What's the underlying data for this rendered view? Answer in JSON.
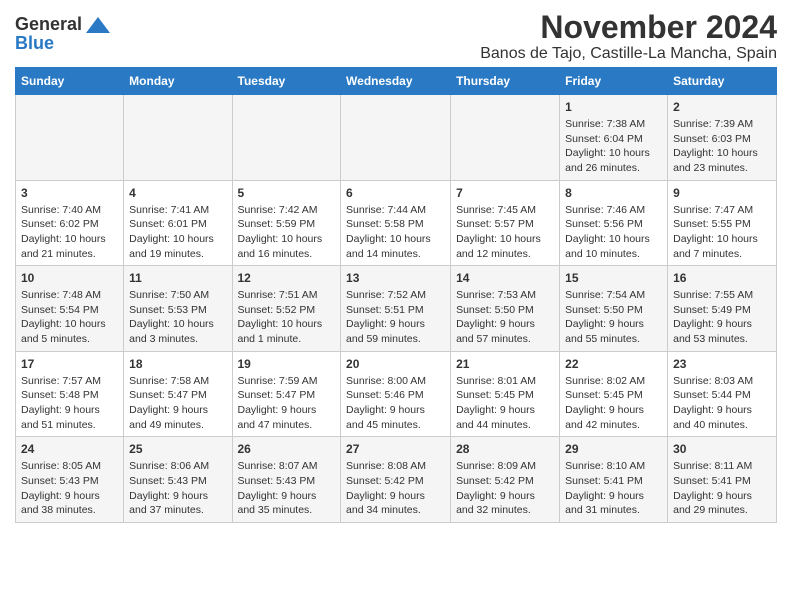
{
  "header": {
    "logo_general": "General",
    "logo_blue": "Blue",
    "title": "November 2024",
    "subtitle": "Banos de Tajo, Castille-La Mancha, Spain"
  },
  "days_of_week": [
    "Sunday",
    "Monday",
    "Tuesday",
    "Wednesday",
    "Thursday",
    "Friday",
    "Saturday"
  ],
  "weeks": [
    [
      {
        "day": "",
        "content": ""
      },
      {
        "day": "",
        "content": ""
      },
      {
        "day": "",
        "content": ""
      },
      {
        "day": "",
        "content": ""
      },
      {
        "day": "",
        "content": ""
      },
      {
        "day": "1",
        "content": "Sunrise: 7:38 AM\nSunset: 6:04 PM\nDaylight: 10 hours and 26 minutes."
      },
      {
        "day": "2",
        "content": "Sunrise: 7:39 AM\nSunset: 6:03 PM\nDaylight: 10 hours and 23 minutes."
      }
    ],
    [
      {
        "day": "3",
        "content": "Sunrise: 7:40 AM\nSunset: 6:02 PM\nDaylight: 10 hours and 21 minutes."
      },
      {
        "day": "4",
        "content": "Sunrise: 7:41 AM\nSunset: 6:01 PM\nDaylight: 10 hours and 19 minutes."
      },
      {
        "day": "5",
        "content": "Sunrise: 7:42 AM\nSunset: 5:59 PM\nDaylight: 10 hours and 16 minutes."
      },
      {
        "day": "6",
        "content": "Sunrise: 7:44 AM\nSunset: 5:58 PM\nDaylight: 10 hours and 14 minutes."
      },
      {
        "day": "7",
        "content": "Sunrise: 7:45 AM\nSunset: 5:57 PM\nDaylight: 10 hours and 12 minutes."
      },
      {
        "day": "8",
        "content": "Sunrise: 7:46 AM\nSunset: 5:56 PM\nDaylight: 10 hours and 10 minutes."
      },
      {
        "day": "9",
        "content": "Sunrise: 7:47 AM\nSunset: 5:55 PM\nDaylight: 10 hours and 7 minutes."
      }
    ],
    [
      {
        "day": "10",
        "content": "Sunrise: 7:48 AM\nSunset: 5:54 PM\nDaylight: 10 hours and 5 minutes."
      },
      {
        "day": "11",
        "content": "Sunrise: 7:50 AM\nSunset: 5:53 PM\nDaylight: 10 hours and 3 minutes."
      },
      {
        "day": "12",
        "content": "Sunrise: 7:51 AM\nSunset: 5:52 PM\nDaylight: 10 hours and 1 minute."
      },
      {
        "day": "13",
        "content": "Sunrise: 7:52 AM\nSunset: 5:51 PM\nDaylight: 9 hours and 59 minutes."
      },
      {
        "day": "14",
        "content": "Sunrise: 7:53 AM\nSunset: 5:50 PM\nDaylight: 9 hours and 57 minutes."
      },
      {
        "day": "15",
        "content": "Sunrise: 7:54 AM\nSunset: 5:50 PM\nDaylight: 9 hours and 55 minutes."
      },
      {
        "day": "16",
        "content": "Sunrise: 7:55 AM\nSunset: 5:49 PM\nDaylight: 9 hours and 53 minutes."
      }
    ],
    [
      {
        "day": "17",
        "content": "Sunrise: 7:57 AM\nSunset: 5:48 PM\nDaylight: 9 hours and 51 minutes."
      },
      {
        "day": "18",
        "content": "Sunrise: 7:58 AM\nSunset: 5:47 PM\nDaylight: 9 hours and 49 minutes."
      },
      {
        "day": "19",
        "content": "Sunrise: 7:59 AM\nSunset: 5:47 PM\nDaylight: 9 hours and 47 minutes."
      },
      {
        "day": "20",
        "content": "Sunrise: 8:00 AM\nSunset: 5:46 PM\nDaylight: 9 hours and 45 minutes."
      },
      {
        "day": "21",
        "content": "Sunrise: 8:01 AM\nSunset: 5:45 PM\nDaylight: 9 hours and 44 minutes."
      },
      {
        "day": "22",
        "content": "Sunrise: 8:02 AM\nSunset: 5:45 PM\nDaylight: 9 hours and 42 minutes."
      },
      {
        "day": "23",
        "content": "Sunrise: 8:03 AM\nSunset: 5:44 PM\nDaylight: 9 hours and 40 minutes."
      }
    ],
    [
      {
        "day": "24",
        "content": "Sunrise: 8:05 AM\nSunset: 5:43 PM\nDaylight: 9 hours and 38 minutes."
      },
      {
        "day": "25",
        "content": "Sunrise: 8:06 AM\nSunset: 5:43 PM\nDaylight: 9 hours and 37 minutes."
      },
      {
        "day": "26",
        "content": "Sunrise: 8:07 AM\nSunset: 5:43 PM\nDaylight: 9 hours and 35 minutes."
      },
      {
        "day": "27",
        "content": "Sunrise: 8:08 AM\nSunset: 5:42 PM\nDaylight: 9 hours and 34 minutes."
      },
      {
        "day": "28",
        "content": "Sunrise: 8:09 AM\nSunset: 5:42 PM\nDaylight: 9 hours and 32 minutes."
      },
      {
        "day": "29",
        "content": "Sunrise: 8:10 AM\nSunset: 5:41 PM\nDaylight: 9 hours and 31 minutes."
      },
      {
        "day": "30",
        "content": "Sunrise: 8:11 AM\nSunset: 5:41 PM\nDaylight: 9 hours and 29 minutes."
      }
    ]
  ]
}
